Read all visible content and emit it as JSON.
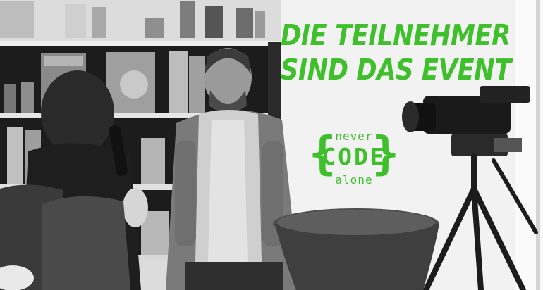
{
  "headline": {
    "line1": "DIE TEILNEHMER",
    "line2": "SIND DAS EVENT"
  },
  "logo": {
    "top_word": "never",
    "center_word": "CODE",
    "bottom_word": "alone",
    "open_brace": "{",
    "close_brace": "}"
  },
  "colors": {
    "accent_green": "#3fbf2c",
    "photo_tone": "grayscale"
  }
}
